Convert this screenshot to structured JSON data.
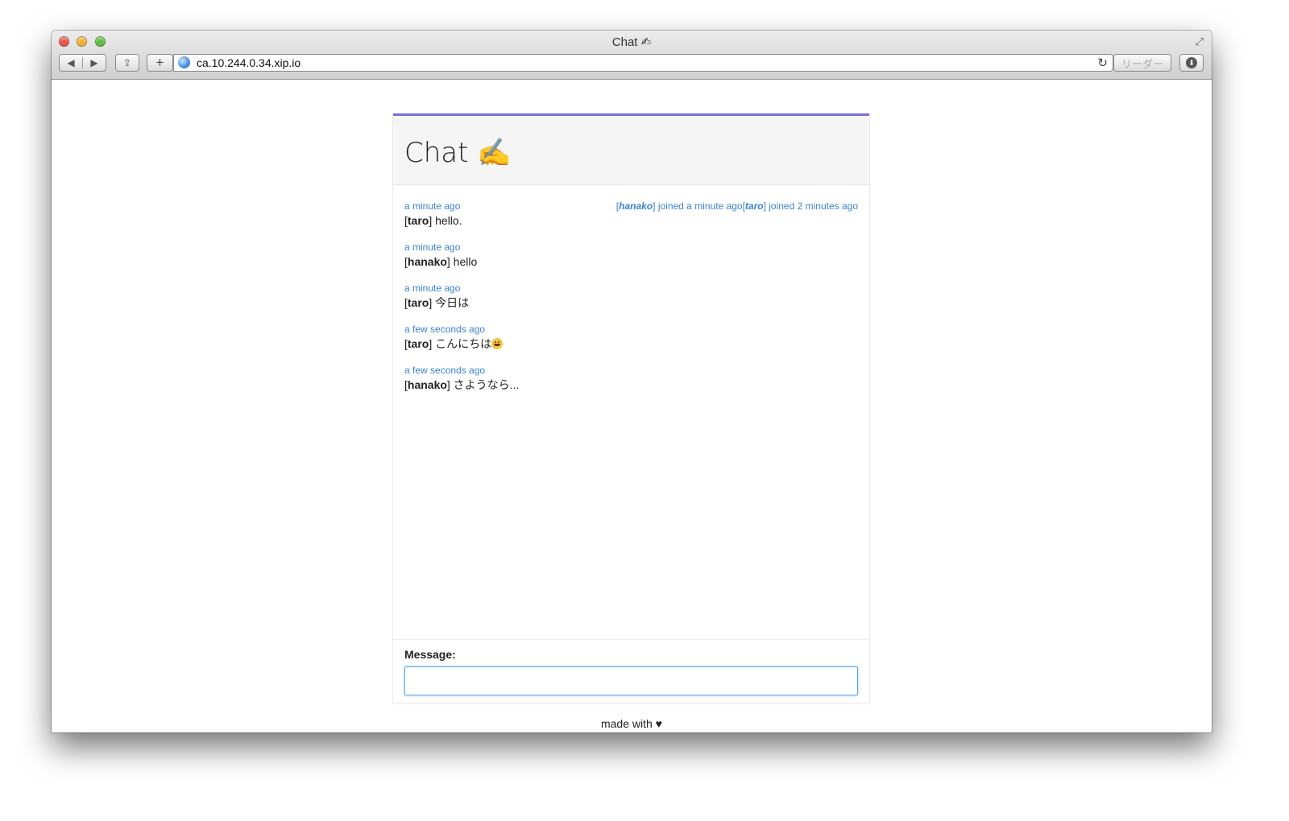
{
  "browser": {
    "window_title": "Chat ✍",
    "url": "ca.10.244.0.34.xip.io",
    "reader_label": "リーダー",
    "back_glyph": "◀",
    "forward_glyph": "▶",
    "share_glyph": "⇪",
    "add_glyph": "+",
    "reload_glyph": "↻",
    "fullscreen_glyph": "⤢",
    "download_glyph": "⬇"
  },
  "app": {
    "title": "Chat ✍",
    "accent_color": "#7a70dc",
    "link_color": "#3a82d4"
  },
  "messages": [
    {
      "time": "a minute ago",
      "user": "taro",
      "text": " hello."
    },
    {
      "time": "a minute ago",
      "user": "hanako",
      "text": " hello"
    },
    {
      "time": "a minute ago",
      "user": "taro",
      "text": " 今日は"
    },
    {
      "time": "a few seconds ago",
      "user": "taro",
      "text": " こんにちは",
      "emoji": "smiley"
    },
    {
      "time": "a few seconds ago",
      "user": "hanako",
      "text": " さようなら..."
    }
  ],
  "presence": [
    {
      "user": "hanako",
      "text": " joined a minute ago"
    },
    {
      "user": "taro",
      "text": " joined 2 minutes ago"
    }
  ],
  "composer": {
    "label": "Message:",
    "value": ""
  },
  "footer": {
    "text": "made with ♥"
  }
}
